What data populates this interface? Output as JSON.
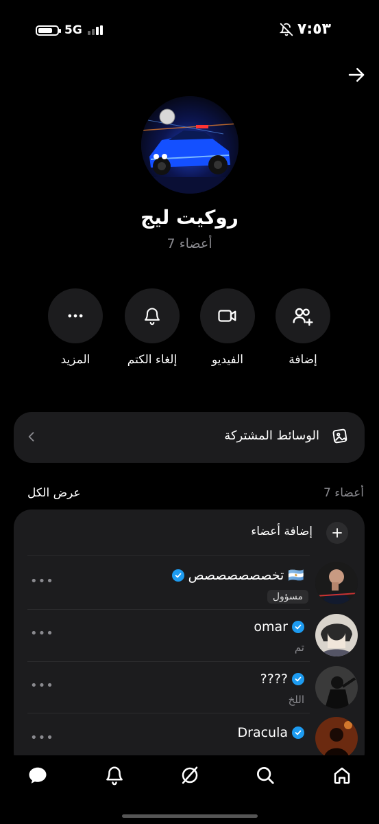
{
  "status_bar": {
    "network": "5G",
    "time": "٧:٥٣"
  },
  "group": {
    "name": "روكيت ليج",
    "members_count": "7 أعضاء"
  },
  "actions": [
    {
      "label": "إضافة",
      "icon": "add-users-icon"
    },
    {
      "label": "الفيديو",
      "icon": "video-icon"
    },
    {
      "label": "إلغاء الكتم",
      "icon": "bell-icon"
    },
    {
      "label": "المزيد",
      "icon": "more-icon"
    }
  ],
  "shared_media": {
    "label": "الوسائط المشتركة",
    "icon": "gallery-icon"
  },
  "members": {
    "count": "7 أعضاء",
    "view_all": "عرض الكل",
    "add_label": "إضافة أعضاء",
    "list": [
      {
        "name": "تخصصصصصصص",
        "flag": "🇦🇷",
        "verified": true,
        "badge": "مسؤول",
        "sub": ""
      },
      {
        "name": "omar",
        "verified": true,
        "sub": "تم"
      },
      {
        "name": "????",
        "verified": true,
        "sub": "اللخ"
      },
      {
        "name": "Dracula",
        "verified": true,
        "sub": ""
      }
    ],
    "more_symbol": "•••"
  },
  "nav": [
    {
      "icon": "chat-icon"
    },
    {
      "icon": "notifications-icon"
    },
    {
      "icon": "explore-icon"
    },
    {
      "icon": "search-icon"
    },
    {
      "icon": "home-icon"
    }
  ],
  "colors": {
    "background": "#000000",
    "surface": "#1c1c1e",
    "accent_verified": "#1d9bf0",
    "secondary_text": "#8a8a8f"
  }
}
